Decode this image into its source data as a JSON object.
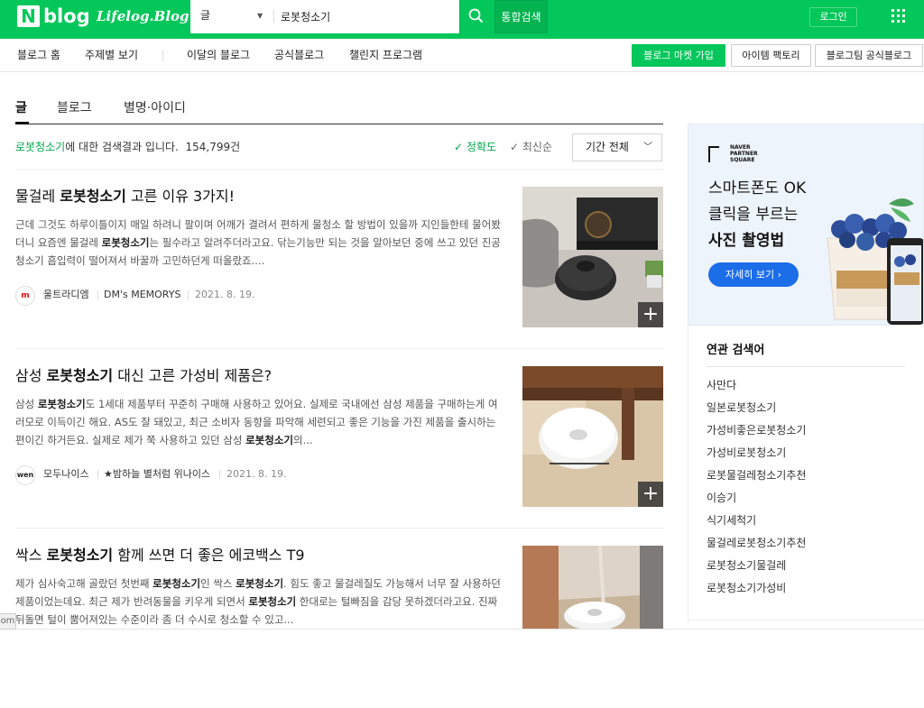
{
  "header": {
    "logo_n": "N",
    "logo_blog": "blog",
    "logo_lifelog": "Lifelog.Blog",
    "search_type": "글",
    "search_value": "로봇청소기",
    "total_search": "통합검색",
    "login": "로그인"
  },
  "subnav": {
    "items": [
      "블로그 홈",
      "주제별 보기",
      "이달의 블로그",
      "공식블로그",
      "챌린지 프로그램"
    ],
    "buttons": [
      "블로그 마켓 가입",
      "아이템 팩토리",
      "블로그팀 공식블로그"
    ]
  },
  "tabs": [
    "글",
    "블로그",
    "별명·아이디"
  ],
  "results": {
    "keyword": "로봇청소기",
    "suffix": "에 대한 검색결과 입니다.",
    "count": "154,799건",
    "sort_accuracy": "정확도",
    "sort_recent": "최신순",
    "period": "기간 전체"
  },
  "posts": [
    {
      "title_pre": "물걸레 ",
      "title_kw": "로봇청소기",
      "title_post": " 고른 이유 3가지!",
      "desc_1": "근데 그것도 하루이틀이지 매일 하려니 팔이며 어깨가 결려서 편하게 물청소 할 방법이 있을까 지인들한테 물어봤더니 요즘엔 물걸레 ",
      "desc_kw": "로봇청소기",
      "desc_2": "는 필수라고 알려주더라고요. 닦는기능만 되는 것을 알아보던 중에 쓰고 있던 진공청소기 흡입력이 떨어져서 바꿀까 고민하던게 떠올랐죠....",
      "avatar": "m",
      "author": "울트라디엠",
      "blog": "DM's MEMORYS",
      "date": "2021. 8. 19."
    },
    {
      "title_pre": "삼성 ",
      "title_kw": "로봇청소기",
      "title_post": " 대신 고른 가성비 제품은?",
      "desc_1": "삼성 ",
      "desc_kw": "로봇청소기",
      "desc_2": "도 1세대 제품부터 꾸준히 구매해 사용하고 있어요. 실제로 국내에선 삼성 제품을 구매하는게 여러모로 이득이긴 해요. AS도 잘 돼있고, 최근 소비자 동향을 파악해 세련되고 좋은 기능을 가진 제품을 출시하는 편이긴 하거든요. 실제로 제가 쭉 사용하고 있던 삼성 ",
      "desc_kw2": "로봇청소기",
      "desc_3": "의...",
      "avatar": "wen",
      "author": "모두나이스",
      "blog": "★밤하늘 별처럼 위나이스",
      "date": "2021. 8. 19."
    },
    {
      "title_pre": "싹스 ",
      "title_kw": "로봇청소기",
      "title_post": " 함께 쓰면 더 좋은 에코백스 T9",
      "desc_1": "제가 심사숙고해 골랐던 첫번째 ",
      "desc_kw": "로봇청소기",
      "desc_2": "인 싹스 ",
      "desc_kw2": "로봇청소기",
      "desc_3": ". 힘도 좋고 물걸레질도 가능해서 너무 잘 사용하던 제품이었는데요. 최근 제가 반려동물을 키우게 되면서 ",
      "desc_kw3": "로봇청소기",
      "desc_4": " 한대로는 털빠짐을 감당 못하겠더라고요. 진짜 뒤돌면 털이 뿜어져있는 수준이라 좀 더 수시로 청소할 수 있고..."
    }
  ],
  "ad": {
    "logo": "NAVER\nPARTNER\nSQUARE",
    "line1": "스마트폰도 OK",
    "line2": "클릭을 부르는",
    "line3": "사진 촬영법",
    "button": "자세히 보기 ›"
  },
  "related": {
    "title": "연관 검색어",
    "items": [
      "사만다",
      "일본로봇청소기",
      "가성비좋은로봇청소기",
      "가성비로봇청소기",
      "로봇물걸레청소기추천",
      "이승기",
      "식기세척기",
      "물걸레로봇청소기추천",
      "로봇청소기물걸레",
      "로봇청소기가성비"
    ]
  },
  "status": "om",
  "colors": {
    "brand": "#03c75a",
    "keyword": "#03a94d",
    "ad_button": "#1c6de8"
  }
}
